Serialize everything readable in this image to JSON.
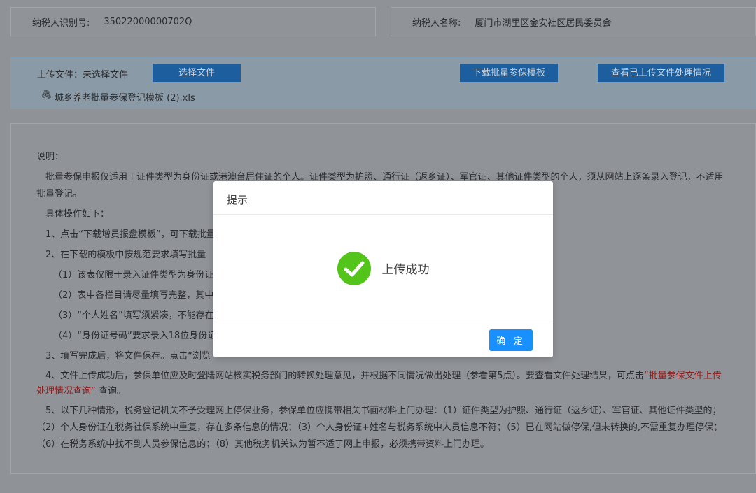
{
  "taxpayer": {
    "id_label": "纳税人识别号:",
    "id_value": "35022000000702Q",
    "name_label": "纳税人名称:",
    "name_value": "厦门市湖里区金安社区居民委员会"
  },
  "upload": {
    "label": "上传文件：未选择文件",
    "choose": "选择文件",
    "download": "下载批量参保模板",
    "view": "查看已上传文件处理情况",
    "file": "城乡养老批量参保登记模板 (2).xls"
  },
  "desc": {
    "title": "说明：",
    "p1": "批量参保申报仅适用于证件类型为身份证或港澳台居住证的个人。证件类型为护照、通行证（返乡证）、军官证、其他证件类型的个人，须从网站上逐条录入登记，不适用批量登记。",
    "p2": "具体操作如下：",
    "s1": "1、点击“下载增员报盘模板”，可下载批量",
    "s2": "2、在下载的模板中按规范要求填写批量",
    "s2a": "（1）该表仅限于录入证件类型为身份证",
    "s2b": "（2）表中各栏目请尽量填写完整，其中",
    "s2c": "（3）“个人姓名”填写须紧凑，不能存在",
    "s2d": "（4）“身份证号码”要求录入18位身份证",
    "s3": "3、填写完成后，将文件保存。点击“浏览",
    "s4": "4、文件上传成功后，参保单位应及时登陆网站核实税务部门的转换处理意见，并根据不同情况做出处理（参看第5点）。要查看文件处理结果，可点击",
    "s4link": "“批量参保文件上传处理情况查询”",
    "s4end": " 查询。",
    "s5": "5、以下几种情形，税务登记机关不予受理网上停保业务，参保单位应携带相关书面材料上门办理：（1）证件类型为护照、通行证（返乡证）、军官证、其他证件类型的；（2）个人身份证在税务社保系统中重复，存在多条信息的情况；（3）个人身份证+姓名与税务系统中人员信息不符；（5）已在网站做停保,但未转换的,不需重复办理停保；（6）在税务系统中找不到人员参保信息的；（8）其他税务机关认为暂不适于网上申报，必须携带资料上门办理。"
  },
  "modal": {
    "title": "提示",
    "message": "上传成功",
    "ok": "确 定"
  }
}
